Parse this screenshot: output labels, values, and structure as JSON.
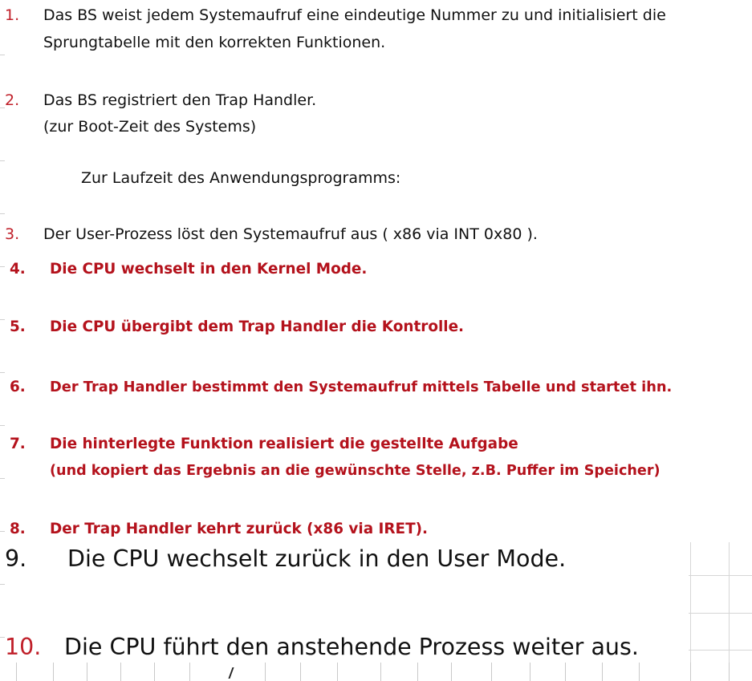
{
  "items": [
    {
      "number": "1.",
      "lines": [
        "Das BS weist jedem Systemaufruf eine eindeutige Nummer zu und initialisiert die",
        "Sprungtabelle mit den korrekten Funktionen."
      ]
    },
    {
      "number": "2.",
      "lines": [
        "Das BS registriert den Trap Handler.",
        "(zur Boot-Zeit des Systems)"
      ]
    },
    {
      "number": "",
      "lines": [
        "Zur Laufzeit des Anwendungsprogramms:"
      ]
    },
    {
      "number": "3.",
      "lines": [
        "Der User-Prozess löst den Systemaufruf aus ( x86 via INT 0x80 )."
      ]
    },
    {
      "number": "4.",
      "lines": [
        "Die CPU wechselt in den Kernel Mode."
      ]
    },
    {
      "number": "5.",
      "lines": [
        "Die CPU übergibt dem Trap Handler die Kontrolle."
      ]
    },
    {
      "number": "6.",
      "lines": [
        "Der Trap Handler bestimmt den Systemaufruf mittels Tabelle und startet ihn."
      ]
    },
    {
      "number": "7.",
      "lines": [
        "Die hinterlegte Funktion realisiert die gestellte Aufgabe",
        "(und kopiert das Ergebnis an die gewünschte Stelle, z.B. Puffer im Speicher)"
      ]
    },
    {
      "number": "8.",
      "lines": [
        "Der Trap Handler kehrt zurück (x86 via IRET)."
      ]
    },
    {
      "number": "9.",
      "lines": [
        "Die CPU wechselt zurück in den User Mode."
      ]
    },
    {
      "number": "10.",
      "lines": [
        "Die CPU führt den anstehende Prozess weiter aus."
      ]
    }
  ],
  "colors": {
    "number_red": "#c0202a",
    "bold_red": "#b4121c",
    "text": "#111111"
  }
}
